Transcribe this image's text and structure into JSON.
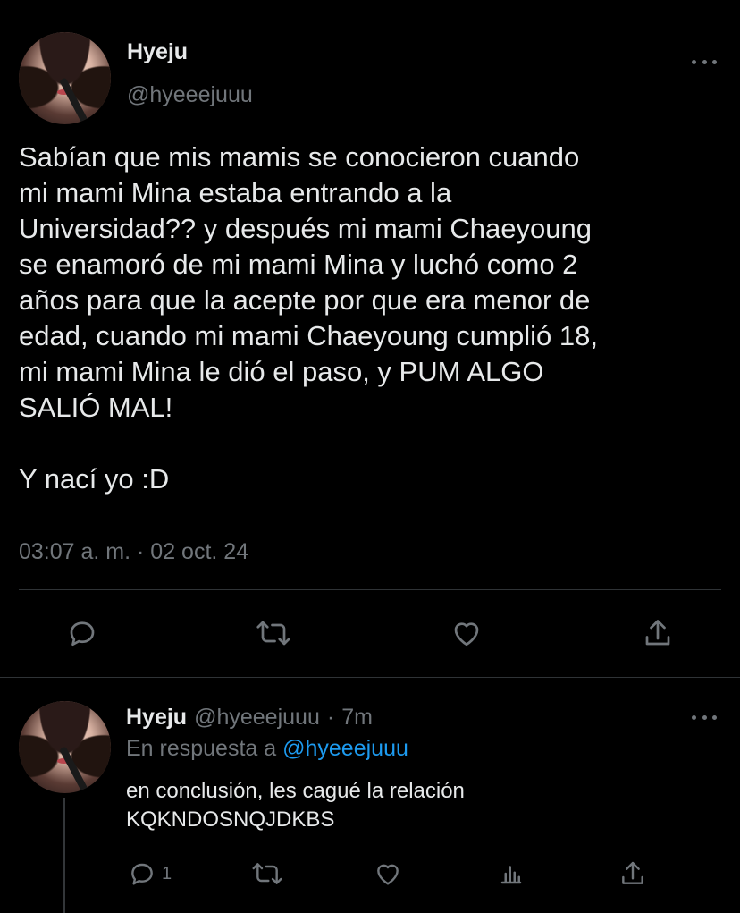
{
  "main_tweet": {
    "author_name": "Hyeju",
    "author_handle": "@hyeeejuuu",
    "text": "Sabían que mis mamis se conocieron cuando\nmi mami Mina estaba entrando a la\nUniversidad?? y después mi mami Chaeyoung\nse enamoró de mi mami Mina y luchó como 2\naños para que la acepte por que era menor de\nedad, cuando mi mami Chaeyoung cumplió 18,\nmi mami Mina le dió el paso, y PUM ALGO\nSALIÓ MAL!\n\nY nací yo :D",
    "timestamp": "03:07 a. m. · 02 oct. 24",
    "actions": [
      "reply-icon",
      "retweet-icon",
      "like-icon",
      "share-icon"
    ]
  },
  "reply_tweet": {
    "author_name": "Hyeju",
    "author_handle": "@hyeeejuuu",
    "separator": "·",
    "time_ago": "7m",
    "replying_to_prefix": "En respuesta a",
    "replying_to_handle": "@hyeeejuuu",
    "text": "en conclusión, les cagué la relación\nKQKNDOSNQJDKBS",
    "reply_count": "1",
    "actions": [
      "reply-icon",
      "retweet-icon",
      "like-icon",
      "stats-icon",
      "share-icon"
    ]
  },
  "colors": {
    "background": "#000000",
    "text_primary": "#e7e9ea",
    "text_secondary": "#71767b",
    "link": "#1d9bf0",
    "divider": "#2f3336"
  }
}
